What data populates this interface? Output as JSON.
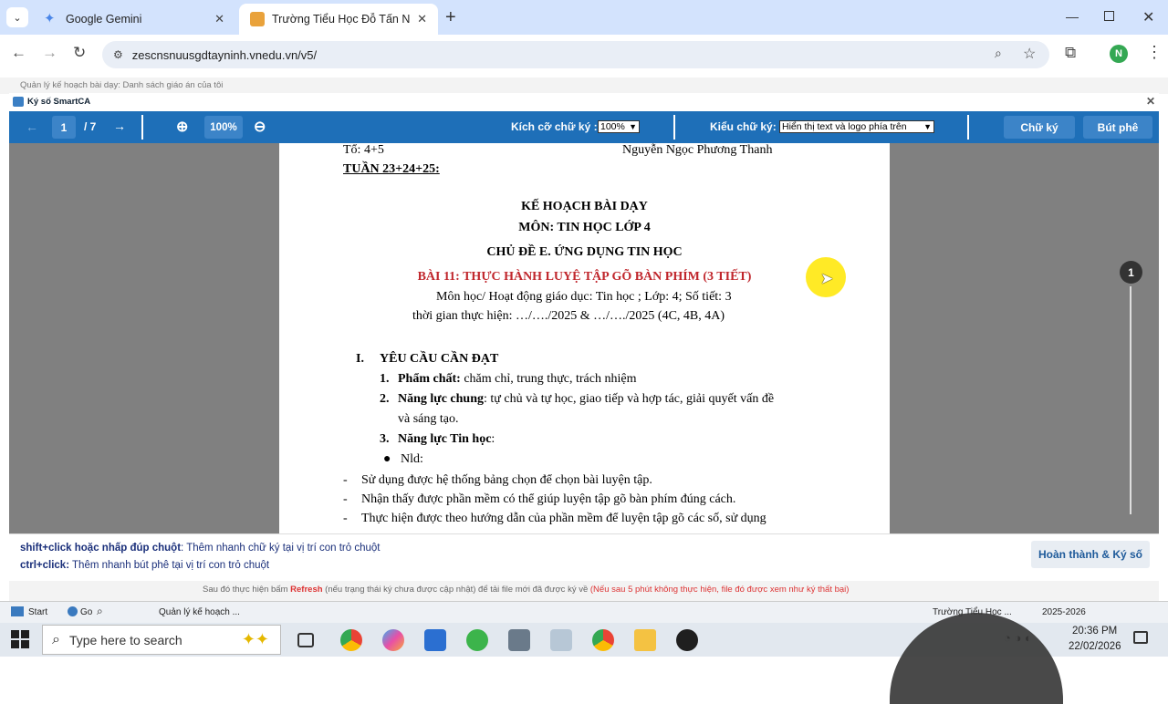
{
  "browser": {
    "tabs": [
      {
        "title": "Google Gemini"
      },
      {
        "title": "Trường Tiểu Học Đỗ Tấn Nhiên"
      }
    ],
    "new_tab": "+",
    "url": "zescnsnuusgdtayninh.vnedu.vn/v5/",
    "profile_initial": "N"
  },
  "page": {
    "window_title": "Quản lý kế hoạch bài dạy: Danh sách giáo án của tôi",
    "dialog_title": "Ký số SmartCA"
  },
  "viewer": {
    "page_current": "1",
    "page_total": "/ 7",
    "zoom": "100%",
    "font_size_label": "Kích cỡ chữ ký :",
    "font_size_value": "100%",
    "font_style_label": "Kiểu chữ ký:",
    "font_style_value": "Hiển thị text và logo phía trên",
    "signature_button": "Chữ ký",
    "comment_button": "Bút phê",
    "page_badge": "1"
  },
  "document": {
    "line_to": "Tổ: 4+5",
    "teacher": "Nguyễn Ngọc Phương Thanh",
    "week": "TUẦN 23+24+25:",
    "heading1": "KẾ HOẠCH BÀI DẠY",
    "heading2": "MÔN: TIN HỌC LỚP 4",
    "topic": "CHỦ ĐỀ E. ỨNG DỤNG TIN HỌC",
    "lesson": "BÀI 11: THỰC HÀNH LUYỆ TẬP GÕ BÀN PHÍM (3 TIẾT)",
    "subject_line": "Môn học/ Hoạt động giáo dục: Tin học ; Lớp: 4; Số tiết: 3",
    "time_line": "thời gian thực hiện: …/…./2025 & …/…./2025  (4C, 4B, 4A)",
    "section1_num": "I.",
    "section1": "YÊU CẦU CẦN ĐẠT",
    "item1_num": "1.",
    "item1_bold": "Phẩm chất:",
    "item1_text": " chăm chỉ, trung thực, trách nhiệm",
    "item2_num": "2.",
    "item2_bold": "Năng lực chung",
    "item2_text": ": tự chủ và tự học, giao tiếp và hợp tác, giải quyết vấn đề",
    "item2_cont": "và sáng tạo.",
    "item3_num": "3.",
    "item3_bold": "Năng lực Tin học",
    "item3_text": ":",
    "bullet": "Nld:",
    "dash1": "Sử dụng được hệ thống bảng chọn để chọn bài luyện tập.",
    "dash2": "Nhận thấy được phần mềm có thể giúp luyện tập gõ bàn phím đúng cách.",
    "dash3": "Thực hiện được theo hướng dẫn của phần mềm để luyện tập gõ các số, sử dụng"
  },
  "hints": {
    "line1_key": "shift+click hoặc nhấp đúp chuột",
    "line1_text": ": Thêm nhanh chữ ký tại vị trí con trỏ chuột",
    "line2_key": "ctrl+click:",
    "line2_text": " Thêm nhanh bút phê tại vị trí con trỏ chuột",
    "finish_button": "Hoàn thành & Ký số"
  },
  "status": {
    "text1": "Sau đó thực hiện bấm",
    "refresh": "Refresh",
    "text2": "(nếu trạng thái ký chưa được cập nhật) để tải file mới đã được ký về",
    "warning": "(Nếu sau 5 phút không thực hiện, file đó được xem như ký thất bại)"
  },
  "appbar": {
    "start": "Start",
    "go": "Go",
    "task": "Quản lý kế hoạch ...",
    "school": "Trường Tiểu Học ...",
    "year": "2025-2026"
  },
  "taskbar": {
    "search_placeholder": "Type here to search",
    "time": "20:36 PM",
    "date": "22/02/2026"
  }
}
